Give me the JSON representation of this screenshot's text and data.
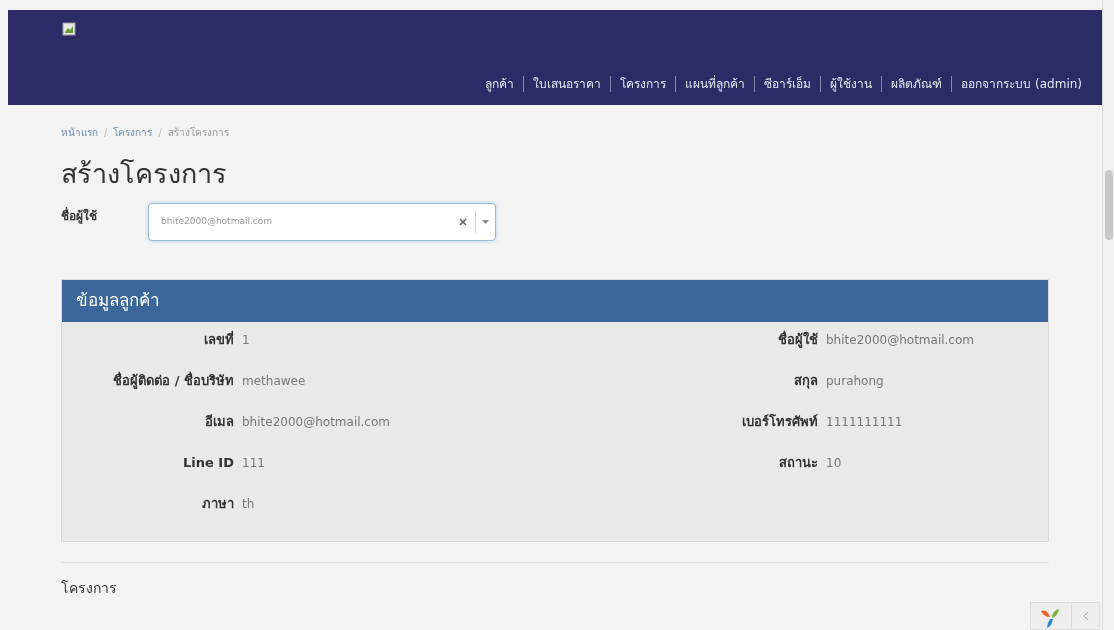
{
  "navbar": {
    "items": [
      {
        "label": "ลูกค้า"
      },
      {
        "label": "ใบเสนอราคา"
      },
      {
        "label": "โครงการ"
      },
      {
        "label": "แผนที่ลูกค้า"
      },
      {
        "label": "ซีอาร์เอ็ม"
      },
      {
        "label": "ผู้ใช้งาน"
      },
      {
        "label": "ผลิตภัณฑ์"
      },
      {
        "label": "ออกจากระบบ (admin)"
      }
    ]
  },
  "breadcrumb_separator": "/",
  "breadcrumb": [
    {
      "label": "หน้าแรก",
      "kind": "link"
    },
    {
      "label": "โครงการ",
      "kind": "link"
    },
    {
      "label": "สร้างโครงการ",
      "kind": "current"
    }
  ],
  "page_title": "สร้างโครงการ",
  "user_field": {
    "label": "ชื่อผู้ใช้",
    "value": "bhite2000@hotmail.com"
  },
  "customer_panel": {
    "title": "ข้อมูลลูกค้า",
    "left": [
      {
        "label": "เลขที่",
        "value": "1"
      },
      {
        "label": "ชื่อผู้ติดต่อ / ชื่อบริษัท",
        "value": "methawee"
      },
      {
        "label": "อีเมล",
        "value": "bhite2000@hotmail.com"
      },
      {
        "label": "Line ID",
        "value": "111"
      },
      {
        "label": "ภาษา",
        "value": "th"
      }
    ],
    "right": [
      {
        "label": "ชื่อผู้ใช้",
        "value": "bhite2000@hotmail.com"
      },
      {
        "label": "สกุล",
        "value": "purahong"
      },
      {
        "label": "เบอร์โทรศัพท์",
        "value": "1111111111"
      },
      {
        "label": "สถานะ",
        "value": "10"
      }
    ]
  },
  "section_title": "โครงการ"
}
